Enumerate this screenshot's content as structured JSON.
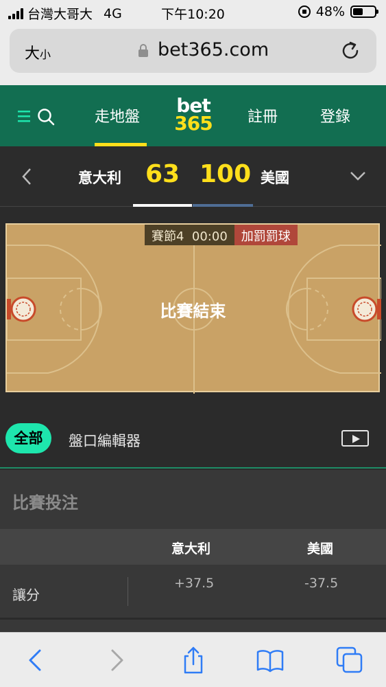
{
  "status_bar": {
    "carrier": "台灣大哥大",
    "network": "4G",
    "time": "下午10:20",
    "battery": "48%",
    "battery_level": 0.48
  },
  "browser": {
    "text_size_label": "大",
    "text_size_small": "小",
    "url": "bet365.com"
  },
  "site_nav": {
    "tab_inplay": "走地盤",
    "logo_top": "bet",
    "logo_bottom": "365",
    "register": "註冊",
    "login": "登錄",
    "brand_color": "#126e51",
    "accent_color": "#ffdf1b"
  },
  "scoreboard": {
    "home_team": "意大利",
    "home_score": "63",
    "away_score": "100",
    "away_team": "美國"
  },
  "court": {
    "period": "賽節4",
    "clock": "00:00",
    "bonus": "加罰罰球",
    "state": "比賽結束"
  },
  "filters": {
    "all": "全部",
    "bet_builder": "盤口編輯器"
  },
  "market": {
    "title": "比賽投注",
    "col_home": "意大利",
    "col_away": "美國",
    "rows": [
      {
        "label": "讓分",
        "home": "+37.5",
        "away": "-37.5"
      }
    ]
  }
}
